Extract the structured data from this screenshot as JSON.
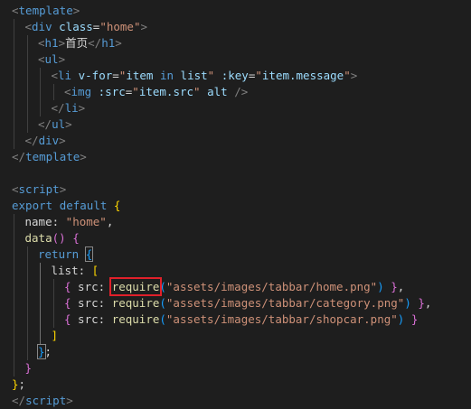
{
  "lines": [
    {
      "indent": 0,
      "tokens": [
        {
          "t": "<",
          "c": "bracket"
        },
        {
          "t": "template",
          "c": "tag"
        },
        {
          "t": ">",
          "c": "bracket"
        }
      ]
    },
    {
      "indent": 1,
      "tokens": [
        {
          "t": "<",
          "c": "bracket"
        },
        {
          "t": "div",
          "c": "tag"
        },
        {
          "t": " ",
          "c": "text"
        },
        {
          "t": "class",
          "c": "attr"
        },
        {
          "t": "=",
          "c": "text"
        },
        {
          "t": "\"home\"",
          "c": "str"
        },
        {
          "t": ">",
          "c": "bracket"
        }
      ]
    },
    {
      "indent": 2,
      "tokens": [
        {
          "t": "<",
          "c": "bracket"
        },
        {
          "t": "h1",
          "c": "tag"
        },
        {
          "t": ">",
          "c": "bracket"
        },
        {
          "t": "首页",
          "c": "text"
        },
        {
          "t": "</",
          "c": "bracket"
        },
        {
          "t": "h1",
          "c": "tag"
        },
        {
          "t": ">",
          "c": "bracket"
        }
      ]
    },
    {
      "indent": 2,
      "tokens": [
        {
          "t": "<",
          "c": "bracket"
        },
        {
          "t": "ul",
          "c": "tag"
        },
        {
          "t": ">",
          "c": "bracket"
        }
      ]
    },
    {
      "indent": 3,
      "tokens": [
        {
          "t": "<",
          "c": "bracket"
        },
        {
          "t": "li",
          "c": "tag"
        },
        {
          "t": " ",
          "c": "text"
        },
        {
          "t": "v-for",
          "c": "attr"
        },
        {
          "t": "=",
          "c": "text"
        },
        {
          "t": "\"",
          "c": "str"
        },
        {
          "t": "item",
          "c": "attr"
        },
        {
          "t": " in ",
          "c": "kw"
        },
        {
          "t": "list",
          "c": "attr"
        },
        {
          "t": "\"",
          "c": "str"
        },
        {
          "t": " ",
          "c": "text"
        },
        {
          "t": ":key",
          "c": "attr"
        },
        {
          "t": "=",
          "c": "text"
        },
        {
          "t": "\"",
          "c": "str"
        },
        {
          "t": "item.message",
          "c": "attr"
        },
        {
          "t": "\"",
          "c": "str"
        },
        {
          "t": ">",
          "c": "bracket"
        }
      ]
    },
    {
      "indent": 4,
      "tokens": [
        {
          "t": "<",
          "c": "bracket"
        },
        {
          "t": "img",
          "c": "tag"
        },
        {
          "t": " ",
          "c": "text"
        },
        {
          "t": ":src",
          "c": "attr"
        },
        {
          "t": "=",
          "c": "text"
        },
        {
          "t": "\"",
          "c": "str"
        },
        {
          "t": "item.src",
          "c": "attr"
        },
        {
          "t": "\"",
          "c": "str"
        },
        {
          "t": " ",
          "c": "text"
        },
        {
          "t": "alt",
          "c": "attr"
        },
        {
          "t": " ",
          "c": "text"
        },
        {
          "t": "/>",
          "c": "bracket"
        }
      ]
    },
    {
      "indent": 3,
      "tokens": [
        {
          "t": "</",
          "c": "bracket"
        },
        {
          "t": "li",
          "c": "tag"
        },
        {
          "t": ">",
          "c": "bracket"
        }
      ]
    },
    {
      "indent": 2,
      "tokens": [
        {
          "t": "</",
          "c": "bracket"
        },
        {
          "t": "ul",
          "c": "tag"
        },
        {
          "t": ">",
          "c": "bracket"
        }
      ]
    },
    {
      "indent": 1,
      "tokens": [
        {
          "t": "</",
          "c": "bracket"
        },
        {
          "t": "div",
          "c": "tag"
        },
        {
          "t": ">",
          "c": "bracket"
        }
      ]
    },
    {
      "indent": 0,
      "tokens": [
        {
          "t": "</",
          "c": "bracket"
        },
        {
          "t": "template",
          "c": "tag"
        },
        {
          "t": ">",
          "c": "bracket"
        }
      ]
    },
    {
      "indent": 0,
      "tokens": []
    },
    {
      "indent": 0,
      "tokens": [
        {
          "t": "<",
          "c": "bracket"
        },
        {
          "t": "script",
          "c": "tag"
        },
        {
          "t": ">",
          "c": "bracket"
        }
      ]
    },
    {
      "indent": 0,
      "tokens": [
        {
          "t": "export",
          "c": "kw"
        },
        {
          "t": " ",
          "c": "text"
        },
        {
          "t": "default",
          "c": "kw"
        },
        {
          "t": " ",
          "c": "text"
        },
        {
          "t": "{",
          "c": "yb"
        }
      ]
    },
    {
      "indent": 1,
      "tokens": [
        {
          "t": "name",
          "c": "prop"
        },
        {
          "t": ": ",
          "c": "text"
        },
        {
          "t": "\"home\"",
          "c": "str"
        },
        {
          "t": ",",
          "c": "text"
        }
      ]
    },
    {
      "indent": 1,
      "tokens": [
        {
          "t": "data",
          "c": "fn"
        },
        {
          "t": "()",
          "c": "pb"
        },
        {
          "t": " ",
          "c": "text"
        },
        {
          "t": "{",
          "c": "pb"
        }
      ]
    },
    {
      "indent": 2,
      "tokens": [
        {
          "t": "return",
          "c": "kw"
        },
        {
          "t": " ",
          "c": "text"
        },
        {
          "t": "{",
          "c": "bb",
          "match": true
        }
      ]
    },
    {
      "indent": 3,
      "tokens": [
        {
          "t": "list",
          "c": "prop"
        },
        {
          "t": ": ",
          "c": "text"
        },
        {
          "t": "[",
          "c": "yb"
        }
      ]
    },
    {
      "indent": 4,
      "tokens": [
        {
          "t": "{",
          "c": "pb"
        },
        {
          "t": " src: ",
          "c": "text"
        },
        {
          "t": "require",
          "c": "fn",
          "highlight": true
        },
        {
          "t": "(",
          "c": "bb"
        },
        {
          "t": "\"assets/images/tabbar/home.png\"",
          "c": "str"
        },
        {
          "t": ")",
          "c": "bb"
        },
        {
          "t": " ",
          "c": "text"
        },
        {
          "t": "}",
          "c": "pb"
        },
        {
          "t": ",",
          "c": "text"
        }
      ]
    },
    {
      "indent": 4,
      "tokens": [
        {
          "t": "{",
          "c": "pb"
        },
        {
          "t": " src: ",
          "c": "text"
        },
        {
          "t": "require",
          "c": "fn"
        },
        {
          "t": "(",
          "c": "bb"
        },
        {
          "t": "\"assets/images/tabbar/category.png\"",
          "c": "str"
        },
        {
          "t": ")",
          "c": "bb"
        },
        {
          "t": " ",
          "c": "text"
        },
        {
          "t": "}",
          "c": "pb"
        },
        {
          "t": ",",
          "c": "text"
        }
      ]
    },
    {
      "indent": 4,
      "tokens": [
        {
          "t": "{",
          "c": "pb"
        },
        {
          "t": " src: ",
          "c": "text"
        },
        {
          "t": "require",
          "c": "fn"
        },
        {
          "t": "(",
          "c": "bb"
        },
        {
          "t": "\"assets/images/tabbar/shopcar.png\"",
          "c": "str"
        },
        {
          "t": ")",
          "c": "bb"
        },
        {
          "t": " ",
          "c": "text"
        },
        {
          "t": "}",
          "c": "pb"
        }
      ]
    },
    {
      "indent": 3,
      "tokens": [
        {
          "t": "]",
          "c": "yb"
        }
      ]
    },
    {
      "indent": 2,
      "tokens": [
        {
          "t": "}",
          "c": "bb",
          "match": true
        },
        {
          "t": ";",
          "c": "text"
        }
      ]
    },
    {
      "indent": 1,
      "tokens": [
        {
          "t": "}",
          "c": "pb"
        }
      ]
    },
    {
      "indent": 0,
      "tokens": [
        {
          "t": "}",
          "c": "yb"
        },
        {
          "t": ";",
          "c": "text"
        }
      ]
    },
    {
      "indent": 0,
      "tokens": [
        {
          "t": "</",
          "c": "bracket"
        },
        {
          "t": "script",
          "c": "tag"
        },
        {
          "t": ">",
          "c": "bracket"
        }
      ]
    }
  ],
  "theme": {
    "background": "#1e1e1e",
    "highlight_box": "#e0202a"
  }
}
